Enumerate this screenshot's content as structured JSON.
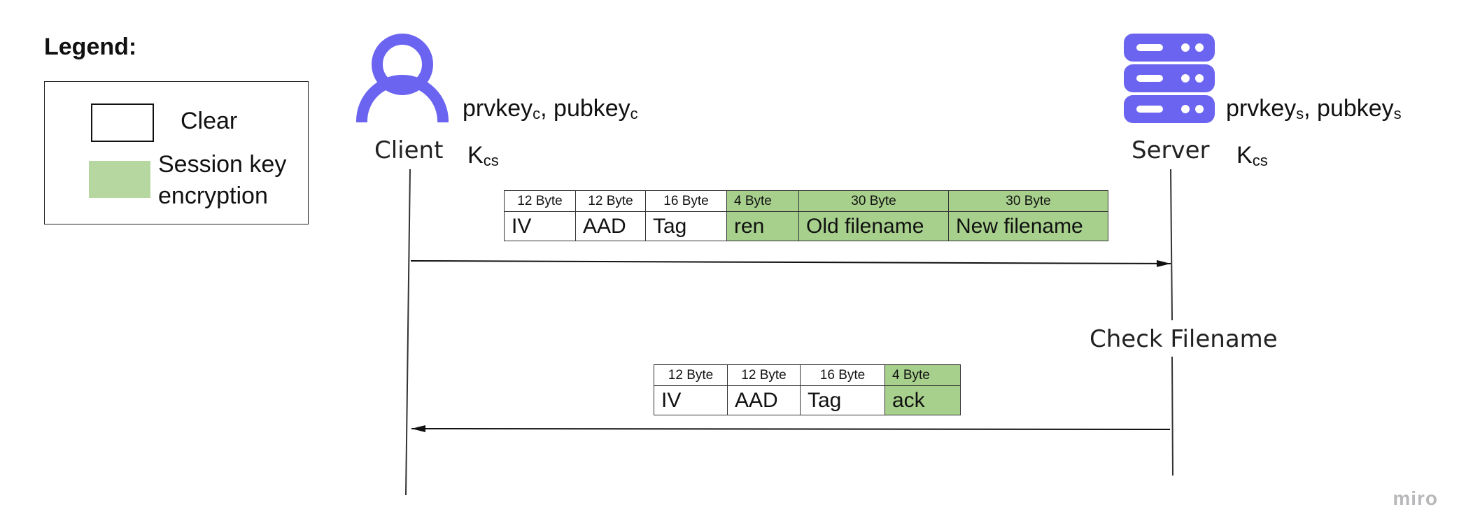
{
  "legend": {
    "title": "Legend:",
    "clear_label": "Clear",
    "session_line1": "Session key",
    "session_line2": "encryption"
  },
  "client": {
    "label": "Client",
    "keys_prv": "prvkey",
    "keys_sub": "c",
    "keys_sep": ", pubkey",
    "kcs_main": "K",
    "kcs_sub": "cs"
  },
  "server": {
    "label": "Server",
    "keys_prv": "prvkey",
    "keys_sub": "s",
    "keys_sep": ", pubkey",
    "kcs_main": "K",
    "kcs_sub": "cs",
    "action": "Check Filename"
  },
  "request_packet": {
    "sizes": [
      "12 Byte",
      "12 Byte",
      "16 Byte",
      "4 Byte",
      "30 Byte",
      "30 Byte"
    ],
    "fields": [
      "IV",
      "AAD",
      "Tag",
      "ren",
      "Old filename",
      "New filename"
    ],
    "encrypted_from": 3
  },
  "response_packet": {
    "sizes": [
      "12 Byte",
      "12 Byte",
      "16 Byte",
      "4 Byte"
    ],
    "fields": [
      "IV",
      "AAD",
      "Tag",
      "ack"
    ],
    "encrypted_from": 3
  },
  "colors": {
    "actor_icon": "#6a64f1",
    "encrypted": "#a8d08d",
    "legend_green": "#b6d7a0"
  },
  "watermark": "miro"
}
